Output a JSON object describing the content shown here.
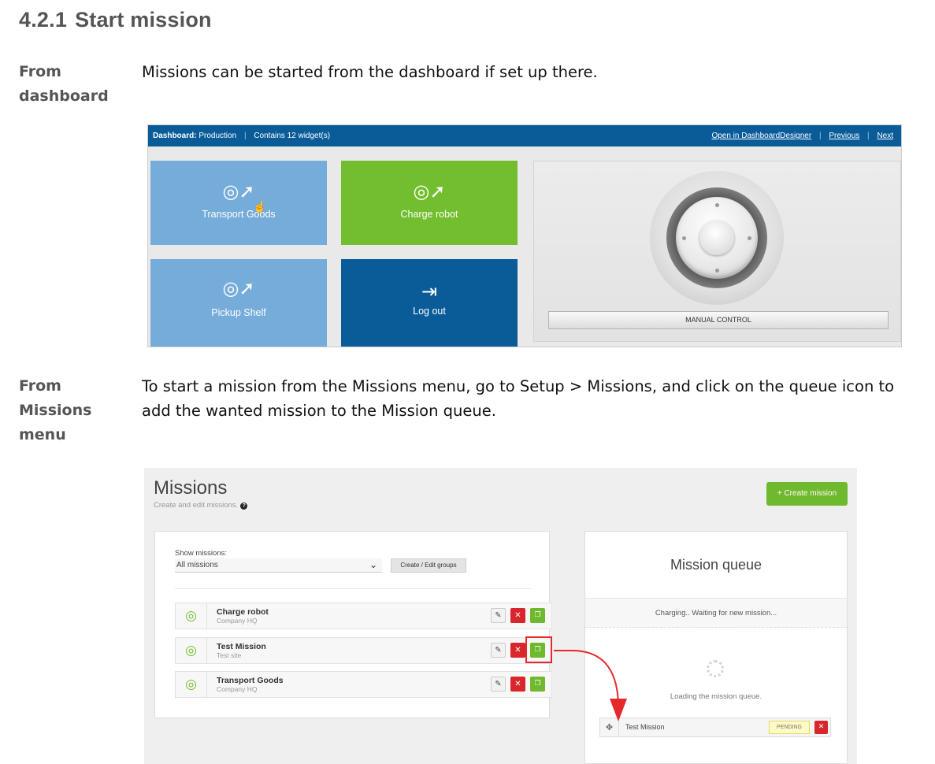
{
  "doc": {
    "heading_number": "4.2.1",
    "heading_title": "Start mission",
    "section1_label_line1": "From",
    "section1_label_line2": "dashboard",
    "section1_text": "Missions can be started from the dashboard if set up there.",
    "section2_label_line1": "From",
    "section2_label_line2": "Missions",
    "section2_label_line3": "menu",
    "section2_text_line1": "To start a mission from the Missions menu, go to Setup > Missions, and click on the queue icon to",
    "section2_text_line2": "add the wanted mission to the Mission queue."
  },
  "dashboard": {
    "label": "Dashboard:",
    "name": "Production",
    "widgets": "Contains 12 widget(s)",
    "link_open": "Open in DashboardDesigner",
    "link_previous": "Previous",
    "link_next": "Next",
    "tiles": [
      {
        "label": "Transport Goods",
        "icon": "mission-target-icon",
        "color": "#76acd9"
      },
      {
        "label": "Charge robot",
        "icon": "mission-target-icon",
        "color": "#72be2e"
      },
      {
        "label": "Pickup Shelf",
        "icon": "mission-target-icon",
        "color": "#76acd9"
      },
      {
        "label": "Log out",
        "icon": "logout-icon",
        "color": "#0a5c99"
      }
    ],
    "manual_control": "MANUAL CONTROL"
  },
  "missions": {
    "title": "Missions",
    "subtitle": "Create and edit missions.",
    "create_button": "+ Create mission",
    "show_label": "Show missions:",
    "filter_value": "All missions",
    "groups_button": "Create / Edit groups",
    "rows": [
      {
        "name": "Charge robot",
        "site": "Company HQ"
      },
      {
        "name": "Test Mission",
        "site": "Test site"
      },
      {
        "name": "Transport Goods",
        "site": "Company HQ"
      }
    ],
    "queue": {
      "title": "Mission queue",
      "status": "Charging.. Waiting for new mission...",
      "loading": "Loading the mission queue.",
      "item_name": "Test Mission",
      "item_status": "PENDING"
    },
    "accent_green": "#6fb92e",
    "accent_red": "#d9262c"
  }
}
